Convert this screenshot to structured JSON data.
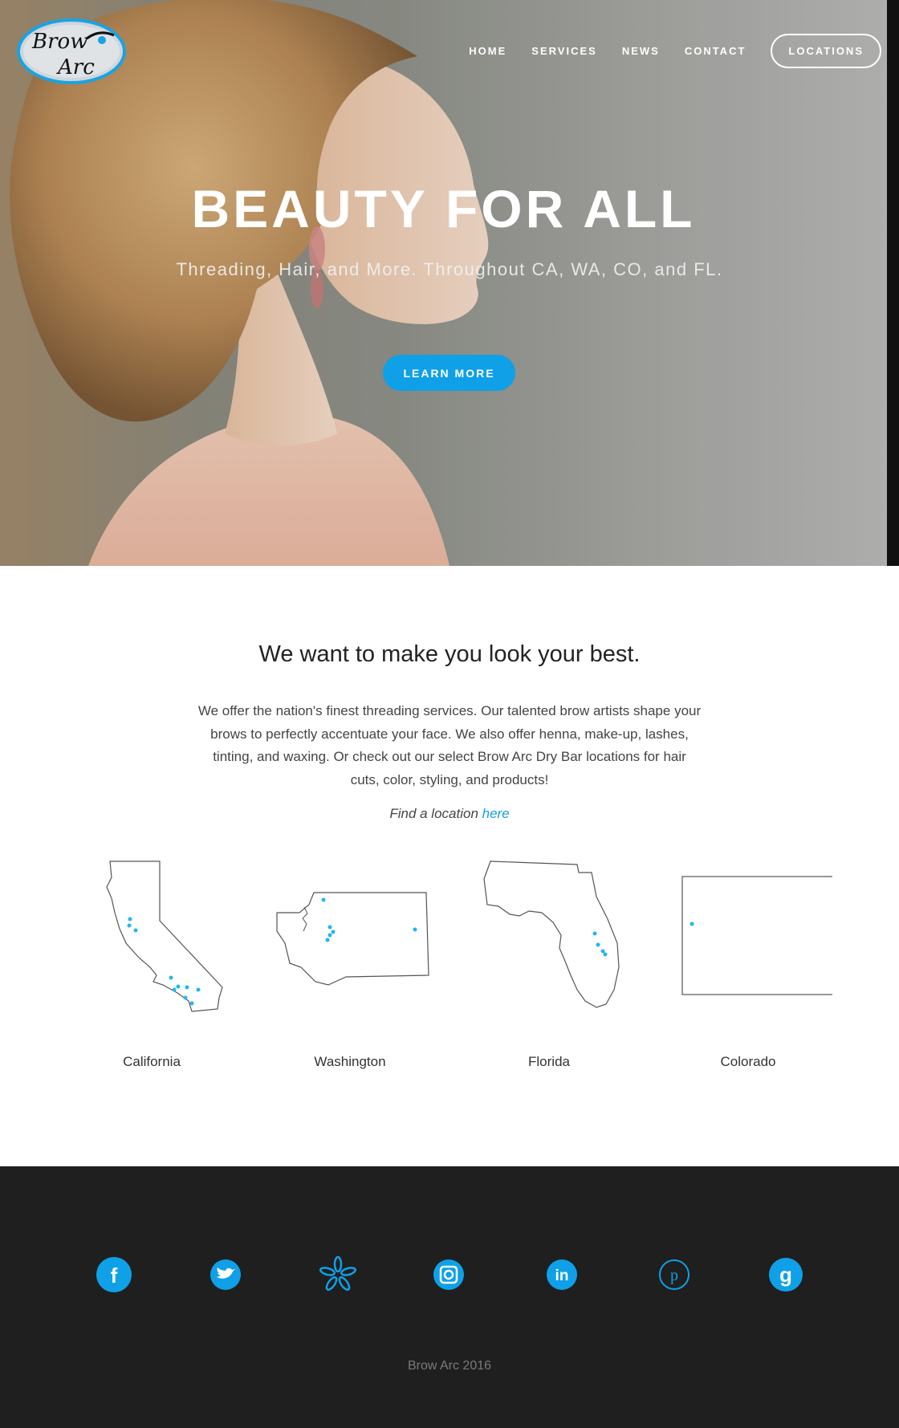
{
  "brand": {
    "logo_line1": "Brow",
    "logo_line2": "Arc",
    "accent": "#0fa0e8"
  },
  "nav": {
    "items": [
      {
        "label": "HOME"
      },
      {
        "label": "SERVICES"
      },
      {
        "label": "NEWS"
      },
      {
        "label": "CONTACT"
      }
    ],
    "cta_label": "LOCATIONS"
  },
  "hero": {
    "title": "BEAUTY FOR ALL",
    "subtitle": "Threading, Hair, and More.  Throughout CA, WA, CO, and FL.",
    "button_label": "LEARN MORE"
  },
  "intro": {
    "heading": "We want to make you look your best.",
    "body": "We offer the nation's finest threading services.  Our talented brow artists shape your brows to perfectly accentuate your face.  We also offer henna, make-up, lashes, tinting, and waxing.  Or check out our select Brow Arc Dry Bar locations for hair cuts, color, styling, and products!",
    "find_prefix": "Find a location ",
    "find_link": "here"
  },
  "states": [
    {
      "name": "California",
      "icon": "california-map-icon"
    },
    {
      "name": "Washington",
      "icon": "washington-map-icon"
    },
    {
      "name": "Florida",
      "icon": "florida-map-icon"
    },
    {
      "name": "Colorado",
      "icon": "colorado-map-icon"
    }
  ],
  "footer": {
    "social": [
      "facebook-icon",
      "twitter-icon",
      "yelp-icon",
      "instagram-icon",
      "linkedin-icon",
      "pinterest-icon",
      "google-icon"
    ],
    "copyright": "Brow Arc 2016"
  }
}
